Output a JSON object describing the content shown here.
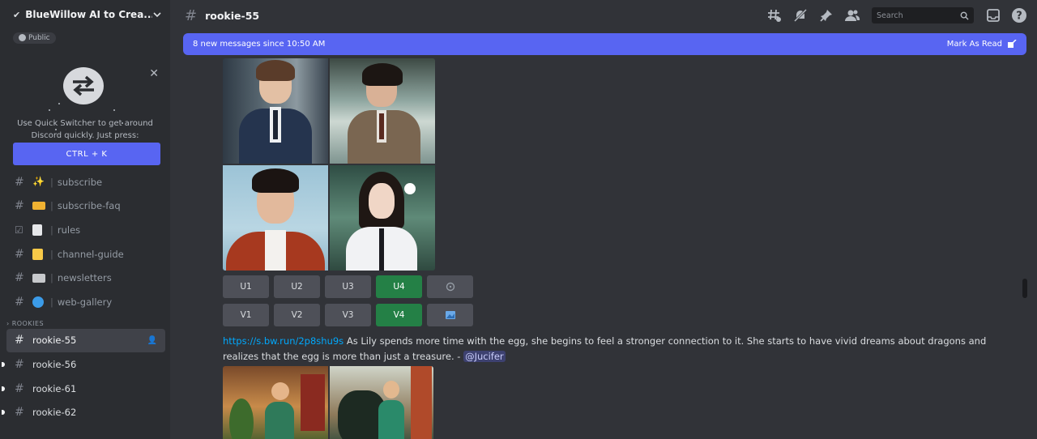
{
  "server": {
    "name": "BlueWillow AI to Crea...",
    "badge": "Public"
  },
  "quick_switcher": {
    "description": "Use Quick Switcher to get around Discord quickly. Just press:",
    "shortcut_label": "CTRL + K"
  },
  "channels": [
    {
      "emoji": "sparkles",
      "name": "subscribe"
    },
    {
      "emoji": "credit-card",
      "name": "subscribe-faq"
    },
    {
      "emoji": "page",
      "name": "rules",
      "icon": "checkbox"
    },
    {
      "emoji": "notepad",
      "name": "channel-guide"
    },
    {
      "emoji": "newspaper",
      "name": "newsletters"
    },
    {
      "emoji": "globe",
      "name": "web-gallery"
    }
  ],
  "section_label": "ROOKIES",
  "rookie_channels": [
    {
      "name": "rookie-55",
      "active": true
    },
    {
      "name": "rookie-56",
      "active": false
    },
    {
      "name": "rookie-61",
      "active": false
    },
    {
      "name": "rookie-62",
      "active": false
    }
  ],
  "header": {
    "channel": "rookie-55",
    "search_placeholder": "Search"
  },
  "new_messages": {
    "text": "8 new messages since 10:50 AM",
    "action": "Mark As Read"
  },
  "upscale_buttons": [
    "U1",
    "U2",
    "U3",
    "U4"
  ],
  "variation_buttons": [
    "V1",
    "V2",
    "V3",
    "V4"
  ],
  "highlighted_button": "U4",
  "message": {
    "link": "https://s.bw.run/2p8shu9s",
    "text": " As Lily spends more time with the egg, she begins to feel a stronger connection to it. She starts to have vivid dreams about dragons and realizes that the egg is more than just a treasure. - ",
    "mention": "@Jucifer"
  },
  "colors": {
    "accent": "#5865f2",
    "green": "#248046",
    "link": "#00a8fc",
    "background": "#313338",
    "sidebar": "#2b2d31"
  }
}
